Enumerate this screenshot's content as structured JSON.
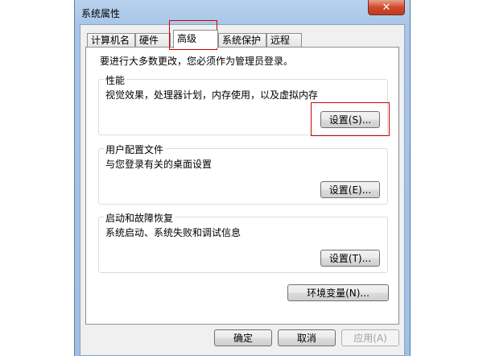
{
  "window": {
    "title": "系统属性"
  },
  "tabs": [
    {
      "label": "计算机名"
    },
    {
      "label": "硬件"
    },
    {
      "label": "高级"
    },
    {
      "label": "系统保护"
    },
    {
      "label": "远程"
    }
  ],
  "admin_note": "要进行大多数更改，您必须作为管理员登录。",
  "groups": {
    "performance": {
      "title": "性能",
      "desc": "视觉效果，处理器计划，内存使用，以及虚拟内存",
      "button": "设置(S)..."
    },
    "profiles": {
      "title": "用户配置文件",
      "desc": "与您登录有关的桌面设置",
      "button": "设置(E)..."
    },
    "startup": {
      "title": "启动和故障恢复",
      "desc": "系统启动、系统失败和调试信息",
      "button": "设置(T)..."
    }
  },
  "env_button": "环境变量(N)...",
  "footer": {
    "ok": "确定",
    "cancel": "取消",
    "apply": "应用(A)"
  }
}
